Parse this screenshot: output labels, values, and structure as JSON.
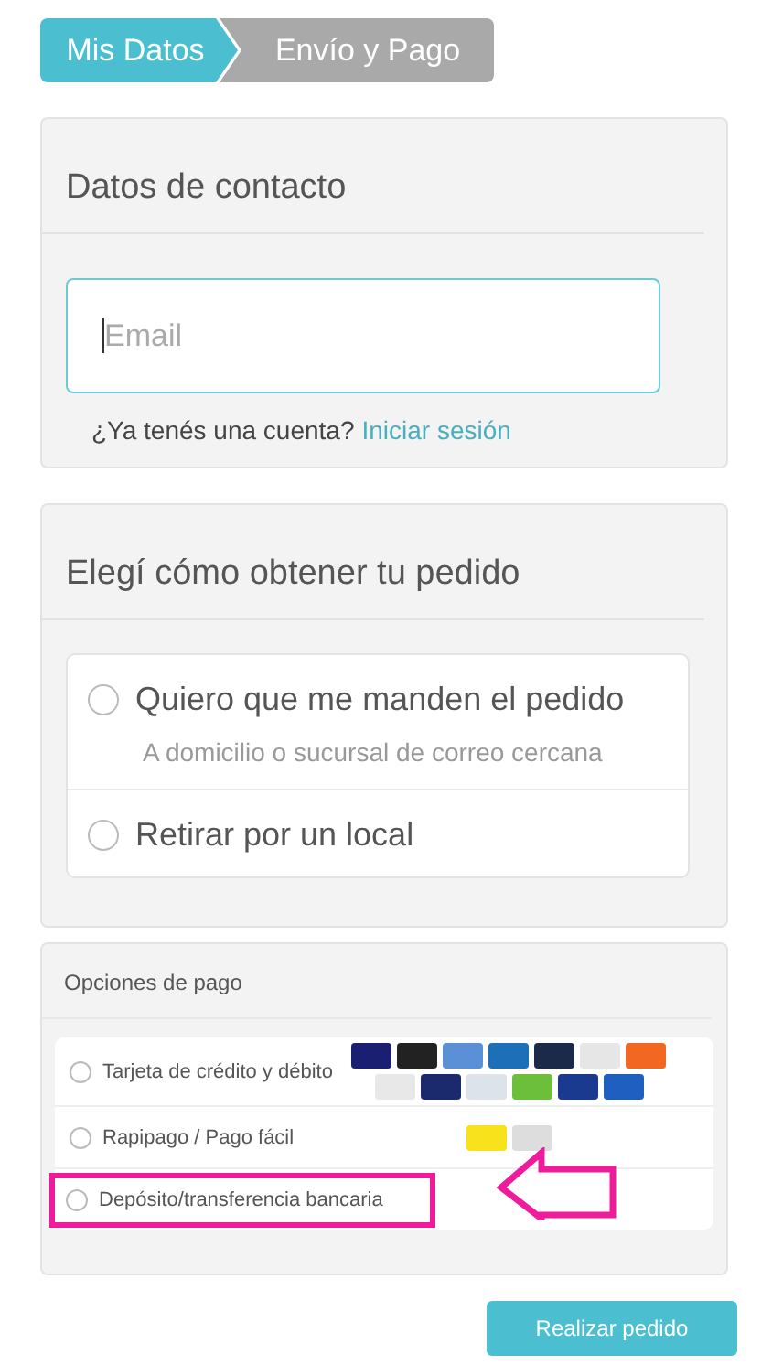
{
  "steps": [
    {
      "label": "Mis Datos",
      "selected": true
    },
    {
      "label": "Envío y Pago",
      "selected": false
    }
  ],
  "contact": {
    "title": "Datos de contacto",
    "email_field": {
      "placeholder": "Email",
      "focused": true
    },
    "account_prompt": "¿Ya tenés una cuenta?",
    "login_link": "Iniciar sesión"
  },
  "shipping": {
    "title": "Elegí cómo obtener tu pedido",
    "options": [
      {
        "label": "Quiero que me manden el pedido",
        "sublabel": "A domicilio o sucursal de correo cercana",
        "selected": false
      },
      {
        "label": "Retirar por un local",
        "selected": false
      }
    ]
  },
  "payment": {
    "title": "Opciones de pago",
    "options": [
      {
        "label": "Tarjeta de crédito y débito",
        "selected": false,
        "highlighted": false,
        "logos": [
          {
            "color": "#1a1f71"
          },
          {
            "color": "#222222"
          },
          {
            "color": "#5b8fd6"
          },
          {
            "color": "#1d6fb8"
          },
          {
            "color": "#1c2a4a"
          },
          {
            "color": "#e6e6e6"
          },
          {
            "color": "#f26722"
          },
          {
            "color": "#e8e8e8"
          },
          {
            "color": "#1a2a6c"
          },
          {
            "color": "#dde3ea"
          },
          {
            "color": "#6cbf3a"
          },
          {
            "color": "#1a3a8f"
          },
          {
            "color": "#1f5fbf"
          }
        ]
      },
      {
        "label": "Rapipago / Pago fácil",
        "selected": false,
        "highlighted": false,
        "logos": [
          {
            "color": "#f7e21b"
          },
          {
            "color": "#dddddd"
          }
        ]
      },
      {
        "label": "Depósito/transferencia bancaria",
        "selected": false,
        "highlighted": true
      }
    ]
  },
  "submit_button": "Realizar pedido"
}
